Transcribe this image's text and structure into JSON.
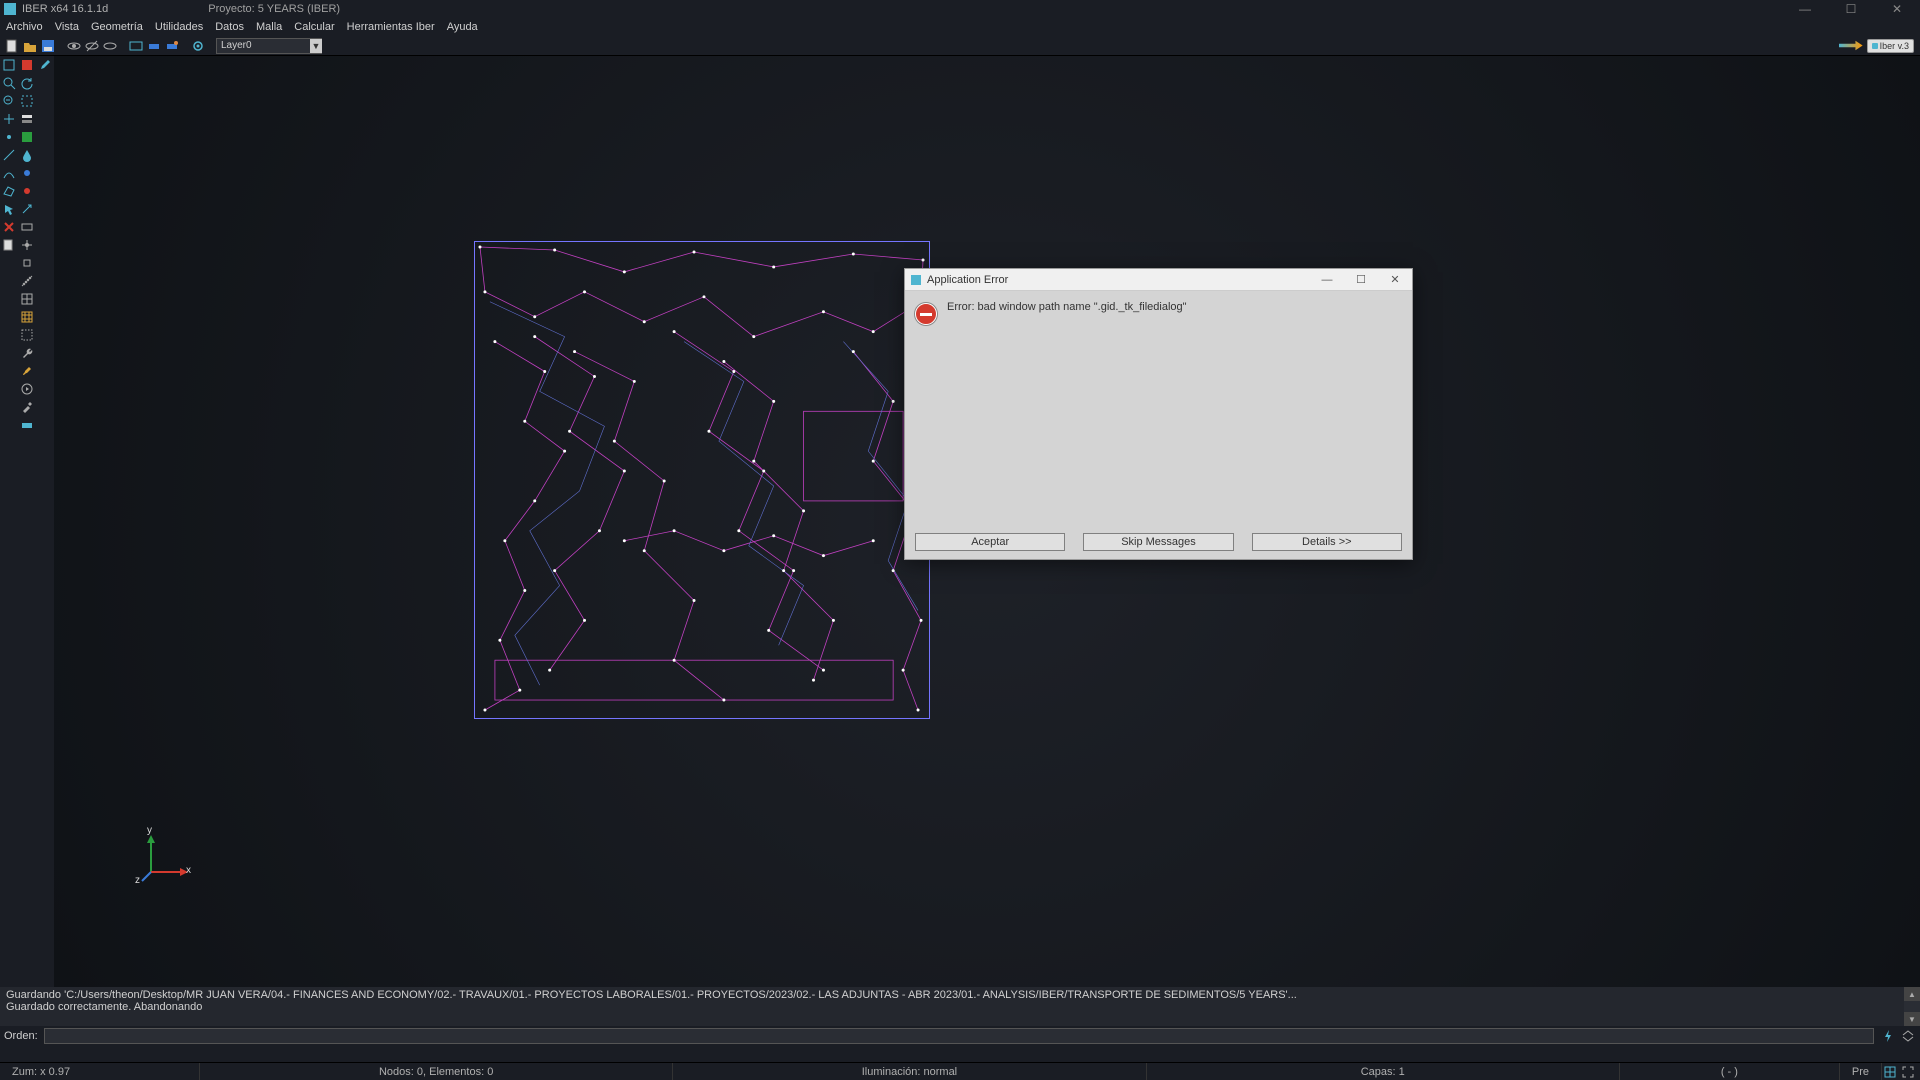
{
  "titlebar": {
    "app_title": "IBER x64 16.1.1d",
    "project_label": "Proyecto: 5 YEARS (IBER)"
  },
  "menubar": {
    "items": [
      "Archivo",
      "Vista",
      "Geometría",
      "Utilidades",
      "Datos",
      "Malla",
      "Calcular",
      "Herramientas Iber",
      "Ayuda"
    ]
  },
  "toptoolbar": {
    "layer_selected": "Layer0",
    "right_badge": "Iber  v.3"
  },
  "dialog": {
    "title": "Application Error",
    "message": "Error: bad window path name \".gid._tk_filedialog\"",
    "buttons": {
      "ok": "Aceptar",
      "skip": "Skip Messages",
      "details": "Details >>"
    }
  },
  "console": {
    "line1": "Guardando 'C:/Users/theon/Desktop/MR JUAN VERA/04.- FINANCES AND ECONOMY/02.- TRAVAUX/01.- PROYECTOS LABORALES/01.- PROYECTOS/2023/02.- LAS ADJUNTAS - ABR 2023/01.- ANALYSIS/IBER/TRANSPORTE DE SEDIMENTOS/5 YEARS'...",
    "line2": "Guardado correctamente. Abandonando",
    "order_label": "Orden:",
    "input_value": ""
  },
  "statusbar": {
    "zoom": "Zum: x 0.97",
    "nodes": "Nodos: 0, Elementos: 0",
    "lighting": "Iluminación: normal",
    "layers": "Capas: 1",
    "coords": "( - )",
    "mode": "Pre"
  },
  "axis": {
    "x": "x",
    "y": "y",
    "z": "z"
  }
}
